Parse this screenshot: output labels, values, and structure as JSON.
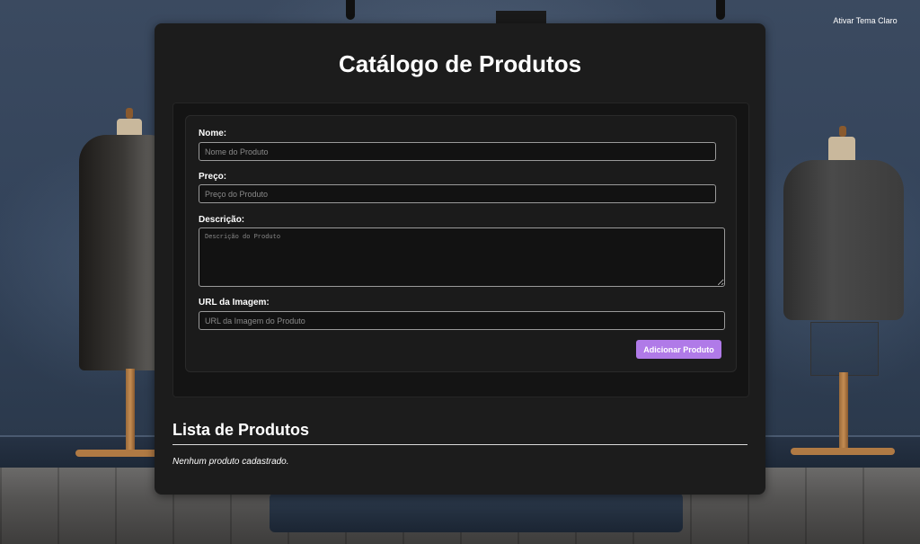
{
  "theme_toggle": {
    "label": "Ativar Tema Claro"
  },
  "page": {
    "title": "Catálogo de Produtos"
  },
  "form": {
    "name": {
      "label": "Nome:",
      "placeholder": "Nome do Produto",
      "value": ""
    },
    "price": {
      "label": "Preço:",
      "placeholder": "Preço do Produto",
      "value": ""
    },
    "description": {
      "label": "Descrição:",
      "placeholder": "Descrição do Produto",
      "value": ""
    },
    "image_url": {
      "label": "URL da Imagem:",
      "placeholder": "URL da Imagem do Produto",
      "value": ""
    },
    "submit_label": "Adicionar Produto"
  },
  "product_list": {
    "title": "Lista de Produtos",
    "empty_message": "Nenhum produto cadastrado.",
    "items": []
  },
  "colors": {
    "accent": "#b07ae8",
    "card_background": "#1c1c1c",
    "text": "#ffffff"
  }
}
